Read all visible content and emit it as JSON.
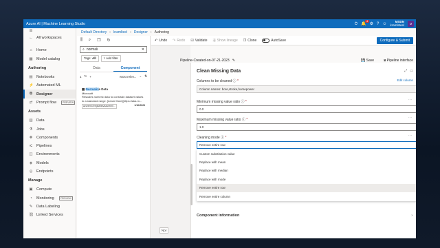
{
  "topbar": {
    "brand": "Azure AI | Machine Learning Studio",
    "notification_count": "4",
    "user_name": "MSDN",
    "user_org": "kramlsteel"
  },
  "breadcrumb": [
    "Default Directory",
    "kramlteel",
    "Designer",
    "Authoring"
  ],
  "nav": {
    "all_workspaces": "All workspaces",
    "home": "Home",
    "model_catalog": "Model catalog",
    "authoring_head": "Authoring",
    "notebooks": "Notebooks",
    "automated_ml": "Automated ML",
    "designer": "Designer",
    "prompt_flow": "Prompt flow",
    "assets_head": "Assets",
    "data": "Data",
    "jobs": "Jobs",
    "components": "Components",
    "pipelines": "Pipelines",
    "environments": "Environments",
    "models": "Models",
    "endpoints": "Endpoints",
    "manage_head": "Manage",
    "compute": "Compute",
    "monitoring": "Monitoring",
    "data_labeling": "Data Labeling",
    "linked_services": "Linked Services",
    "preview_tag": "PREVIEW"
  },
  "assets": {
    "search_value": "normali",
    "tags_label": "Tags:",
    "tags_all": "All",
    "add_filter": "Add filter",
    "tab_data": "Data",
    "tab_component": "Component",
    "count": "1",
    "sort": "Most relev...",
    "card_title_match": "Normaliz",
    "card_title_rest": "e Data",
    "card_author": "Microsoft",
    "card_desc": "Rescales numeric data to constrain dataset values to a standard range. [Learn More](https://aka.m...",
    "card_tag": "azureml://registries/azureml/...",
    "card_date": "1/10/2023"
  },
  "toolbar": {
    "undo": "Undo",
    "redo": "Redo",
    "validate": "Validate",
    "show_lineage": "Show lineage",
    "clone": "Clone",
    "autosave": "AutoSave",
    "configure": "Configure & Submit"
  },
  "canvas": {
    "pipeline_name": "Pipeline-Created-on-07-21-2023",
    "save": "Save",
    "pipeline_interface": "Pipeline interface",
    "node_stub": "Nor"
  },
  "props": {
    "title": "Clean Missing Data",
    "columns_label": "Columns to be cleaned",
    "columns_value": "Column names: bore,stroke,horsepower",
    "edit_column": "Edit column",
    "min_label": "Minimum missing value ratio",
    "min_value": "0.0",
    "max_label": "Maximum missing value ratio",
    "max_value": "1.0",
    "mode_label": "Cleaning mode",
    "mode_value": "Remove entire row",
    "options": [
      "Custom substitution value",
      "Replace with mean",
      "Replace with median",
      "Replace with mode",
      "Remove entire row",
      "Remove entire column"
    ],
    "component_info": "Component information"
  }
}
